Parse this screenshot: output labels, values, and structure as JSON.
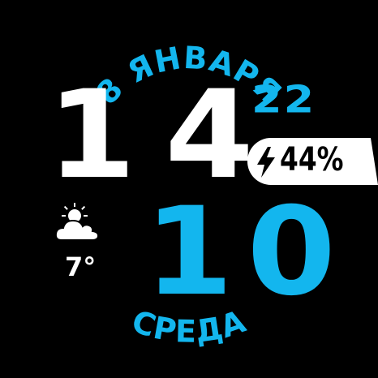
{
  "date": {
    "label": "8 ЯНВАРЯ"
  },
  "weekday": {
    "label": "СРЕДА"
  },
  "time": {
    "hour": "14",
    "minute": "10",
    "second": "22"
  },
  "battery": {
    "level_text": "44%",
    "level": 44,
    "icon": "lightning-bolt-icon"
  },
  "weather": {
    "icon": "partly-cloudy-icon",
    "temperature": "7°"
  },
  "colors": {
    "background": "#000000",
    "accent": "#13b6ee",
    "primary": "#ffffff"
  }
}
